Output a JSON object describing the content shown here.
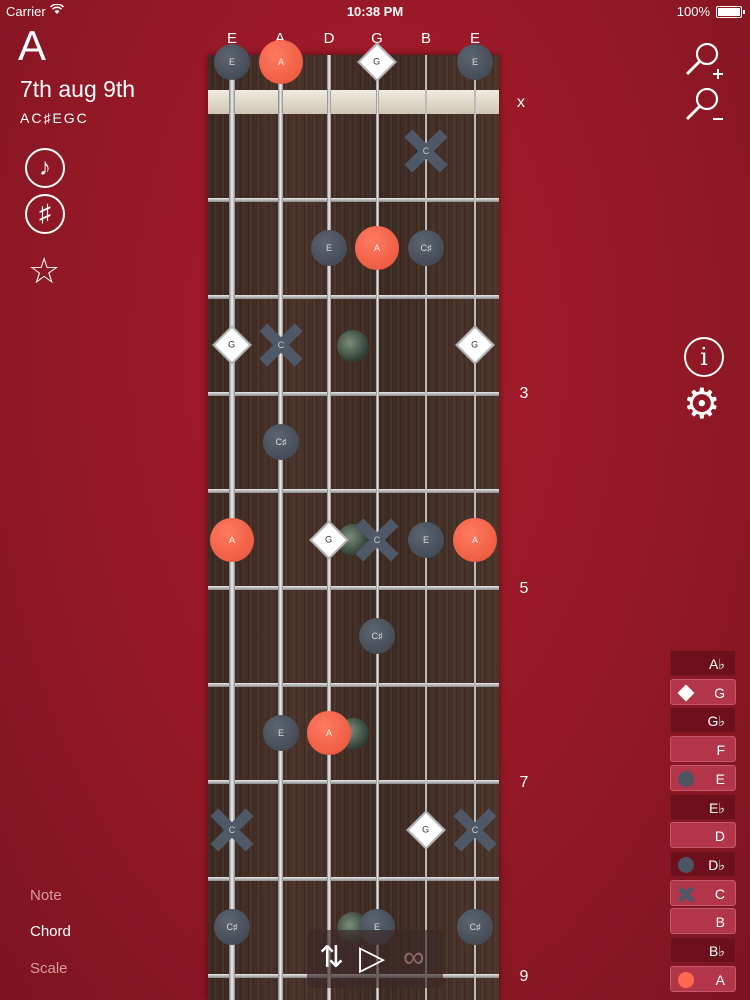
{
  "status": {
    "carrier": "Carrier",
    "wifi": "wifi-icon",
    "time": "10:38 PM",
    "battery": "100%"
  },
  "chord": {
    "root": "A",
    "name": "7th aug 9th",
    "notes": "AC♯EGC"
  },
  "left_buttons": {
    "note_glyph": "♪",
    "sharp_glyph": "♯",
    "star_glyph": "☆"
  },
  "modes": {
    "note": "Note",
    "chord": "Chord",
    "scale": "Scale"
  },
  "strings": [
    "E",
    "A",
    "D",
    "G",
    "B",
    "E"
  ],
  "open_marker": "x",
  "fret_numbers": [
    "3",
    "5",
    "7",
    "9"
  ],
  "markers": [
    {
      "type": "e",
      "label": "E"
    },
    {
      "type": "a",
      "label": "A"
    },
    {
      "type": "g",
      "label": "G"
    },
    {
      "type": "e",
      "label": "E"
    },
    {
      "type": "c",
      "label": "C"
    },
    {
      "type": "e",
      "label": "E"
    },
    {
      "type": "a",
      "label": "A"
    },
    {
      "type": "e",
      "label": "C♯"
    },
    {
      "type": "g",
      "label": "G"
    },
    {
      "type": "c",
      "label": "C"
    },
    {
      "type": "g",
      "label": "G"
    },
    {
      "type": "e",
      "label": "C♯"
    },
    {
      "type": "a",
      "label": "A"
    },
    {
      "type": "g",
      "label": "G"
    },
    {
      "type": "c",
      "label": "C"
    },
    {
      "type": "e",
      "label": "E"
    },
    {
      "type": "a",
      "label": "A"
    },
    {
      "type": "e",
      "label": "C♯"
    },
    {
      "type": "e",
      "label": "E"
    },
    {
      "type": "a",
      "label": "A"
    },
    {
      "type": "c",
      "label": "C"
    },
    {
      "type": "g",
      "label": "G"
    },
    {
      "type": "c",
      "label": "C"
    },
    {
      "type": "e",
      "label": "C♯"
    },
    {
      "type": "e",
      "label": "E"
    },
    {
      "type": "e",
      "label": "C♯"
    }
  ],
  "legend": [
    {
      "label": "A♭",
      "state": "off",
      "swatch": ""
    },
    {
      "label": "G",
      "state": "on",
      "swatch": "g"
    },
    {
      "label": "G♭",
      "state": "off",
      "swatch": ""
    },
    {
      "label": "F",
      "state": "on",
      "swatch": ""
    },
    {
      "label": "E",
      "state": "on",
      "swatch": "e"
    },
    {
      "label": "E♭",
      "state": "off",
      "swatch": ""
    },
    {
      "label": "D",
      "state": "on",
      "swatch": ""
    },
    {
      "label": "D♭",
      "state": "off",
      "swatch": "e"
    },
    {
      "label": "C",
      "state": "on",
      "swatch": "c"
    },
    {
      "label": "B",
      "state": "on",
      "swatch": ""
    },
    {
      "label": "B♭",
      "state": "off",
      "swatch": ""
    },
    {
      "label": "A",
      "state": "on",
      "swatch": "a"
    }
  ],
  "toolbar": {
    "flip_glyph": "⇅",
    "play_glyph": "▷",
    "loop_glyph": "∞"
  },
  "right_icons": {
    "zoom_in": "zoom-in-icon",
    "zoom_out": "zoom-out-icon",
    "info_glyph": "i",
    "gear_glyph": "⚙"
  }
}
